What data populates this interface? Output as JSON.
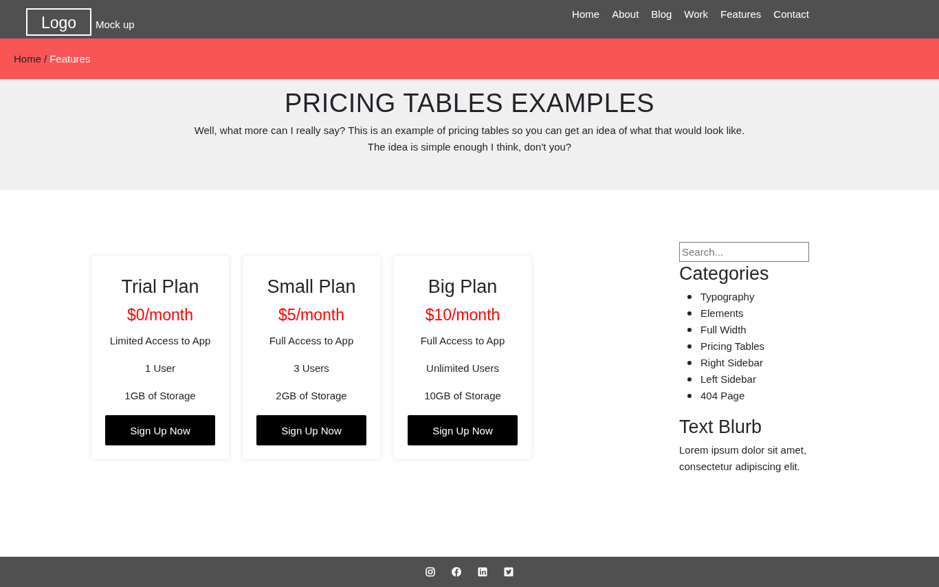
{
  "header": {
    "logo": "Logo",
    "tagline": "Mock up",
    "nav": [
      {
        "label": "Home"
      },
      {
        "label": "About"
      },
      {
        "label": "Blog"
      },
      {
        "label": "Work"
      },
      {
        "label": "Features"
      },
      {
        "label": "Contact"
      }
    ]
  },
  "breadcrumb": {
    "separator": "/",
    "items": [
      {
        "label": "Home",
        "current": false
      },
      {
        "label": "Features",
        "current": true
      }
    ]
  },
  "hero": {
    "title": "PRICING TABLES EXAMPLES",
    "lines": [
      "Well, what more can I really say? This is an example of pricing tables so you can get an idea of what that would look like.",
      "The idea is simple enough I think, don't you?"
    ]
  },
  "plans": [
    {
      "name": "Trial Plan",
      "price": "$0/month",
      "features": [
        "Limited Access to App",
        "1 User",
        "1GB of Storage"
      ],
      "button": "Sign Up Now"
    },
    {
      "name": "Small Plan",
      "price": "$5/month",
      "features": [
        "Full Access to App",
        "3 Users",
        "2GB of Storage"
      ],
      "button": "Sign Up Now"
    },
    {
      "name": "Big Plan",
      "price": "$10/month",
      "features": [
        "Full Access to App",
        "Unlimited Users",
        "10GB of Storage"
      ],
      "button": "Sign Up Now"
    }
  ],
  "sidebar": {
    "search": {
      "placeholder": "Search..."
    },
    "categories_title": "Categories",
    "categories": [
      "Typography",
      "Elements",
      "Full Width",
      "Pricing Tables",
      "Right Sidebar",
      "Left Sidebar",
      "404 Page"
    ],
    "blurb_title": "Text Blurb",
    "blurb": "Lorem ipsum dolor sit amet, consectetur adipiscing elit."
  },
  "footer": {
    "social": [
      {
        "kind": "instagram"
      },
      {
        "kind": "facebook"
      },
      {
        "kind": "linkedin"
      },
      {
        "kind": "twitter"
      }
    ]
  }
}
